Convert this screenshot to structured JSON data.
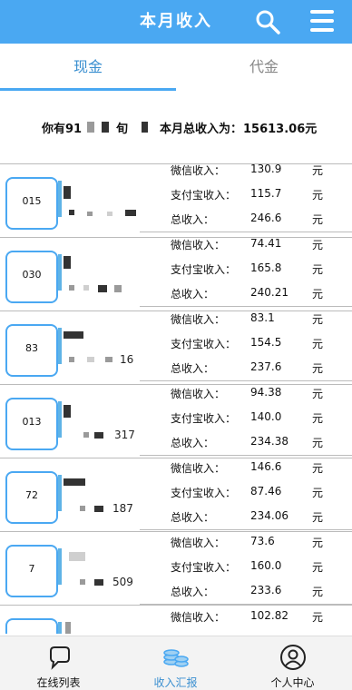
{
  "header": {
    "title": "本月收入",
    "icons": [
      "search-icon",
      "menu-icon"
    ],
    "color": "#4aa8f2"
  },
  "tabs": [
    {
      "label": "现金",
      "active": true
    },
    {
      "label": "代金",
      "active": false
    }
  ],
  "summary": {
    "prefix": "你有91",
    "mid": "旬",
    "total_label": "本月总收入为：",
    "total_value": "15613.06元"
  },
  "labels": {
    "wechat": "微信收入：",
    "alipay": "支付宝收入：",
    "total": "总收入：",
    "unit": "元"
  },
  "rows": [
    {
      "code": "015",
      "tail": "",
      "wechat": "130.9",
      "alipay": "115.7",
      "total": "246.6"
    },
    {
      "code": "030",
      "tail": "",
      "wechat": "74.41",
      "alipay": "165.8",
      "total": "240.21"
    },
    {
      "code": "83",
      "tail": "16",
      "wechat": "83.1",
      "alipay": "154.5",
      "total": "237.6"
    },
    {
      "code": "013",
      "tail": "317",
      "wechat": "94.38",
      "alipay": "140.0",
      "total": "234.38"
    },
    {
      "code": "72",
      "tail": "187",
      "wechat": "146.6",
      "alipay": "87.46",
      "total": "234.06"
    },
    {
      "code": "7",
      "tail": "509",
      "wechat": "73.6",
      "alipay": "160.0",
      "total": "233.6"
    },
    {
      "code": "",
      "tail": "",
      "wechat": "102.82",
      "alipay": "",
      "total": ""
    }
  ],
  "bottom_nav": [
    {
      "label": "在线列表",
      "icon": "chat-bubble-icon",
      "active": false
    },
    {
      "label": "收入汇报",
      "icon": "coins-icon",
      "active": true
    },
    {
      "label": "个人中心",
      "icon": "user-icon",
      "active": false
    }
  ]
}
